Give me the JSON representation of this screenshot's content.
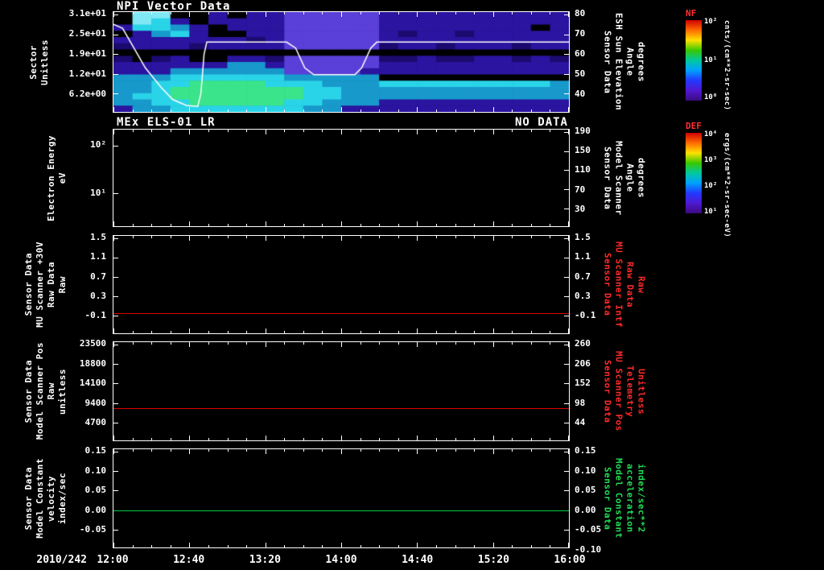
{
  "chart_data": [
    {
      "type": "heatmap",
      "title": "NPI Vector Data",
      "y_left": {
        "label_lines": [
          "Sector",
          "Unitless"
        ],
        "ticks": [
          "3.1e+01",
          "2.5e+01",
          "1.9e+01",
          "1.2e+01",
          "6.2e+00"
        ],
        "fracs": [
          0.024,
          0.222,
          0.42,
          0.619,
          0.817
        ]
      },
      "y_right": {
        "label_lines": [
          "Sensor Data",
          "ESH Sun Elevation",
          "Angle",
          "degrees"
        ],
        "ticks": [
          "80",
          "70",
          "60",
          "50",
          "40"
        ],
        "fracs": [
          0.024,
          0.222,
          0.42,
          0.619,
          0.817
        ],
        "color": "#ffffff"
      },
      "xlim": [
        "12:00",
        "16:00"
      ],
      "palette": {
        "K": "#000000",
        "N": "#1c0a6e",
        "D": "#2a14a0",
        "P": "#5a3fd8",
        "T": "#1899cc",
        "C": "#2ad4e8",
        "G": "#3ae48a",
        "L": "#7fe8f4"
      },
      "grid_rows": [
        "KLLKKDKDDPPPPPDDDDDDDDDD",
        "KLCDKDDDDPPPPPDDDDDDDDDD",
        "DCCTDKDDDPPPPPDDDDDDDDKD",
        "KDTCDKKDDPPPPPDNDDNDDDDD",
        "DDDDDDDNDPPPPPDDDDDDDDDD",
        "NDDDNDDDDPPPPPNDDNDDDNDD",
        "KKKKKKKKKKKKKKKKKKKKKKKK",
        "NKNDKKDDNPPPPPNNDNNDDNDN",
        "DDDDDDTTDPPPPPDDDDDDDDDD",
        "DDDTTTTTTPPPPDDDDDDDDDDD",
        "TTTCCCCCCTTTTTKKKKKKKKKK",
        "TTCCGGGGCCCTTTCCCCCCCCCT",
        "TTCGGGGGGGCCTTTTTTTTTTTT",
        "TCCGGGGGGGCCTTTTTTTTTTTT",
        "TTCCGGGGGCCTTTDDDDDDDDDD",
        "DTTCCCCCCCTTDDDDDDDDDDDD"
      ],
      "overlay_line": {
        "name": "ESH Sun Elevation Angle",
        "units": "degrees",
        "color": "#ffffff",
        "y_ref": {
          "top_value": 80,
          "frac_at_top": 0.024,
          "frac_per_degree": 0.0198
        },
        "points": [
          [
            0.0,
            75
          ],
          [
            0.02,
            73
          ],
          [
            0.045,
            63
          ],
          [
            0.07,
            53
          ],
          [
            0.105,
            43
          ],
          [
            0.13,
            37
          ],
          [
            0.16,
            34
          ],
          [
            0.185,
            33.5
          ],
          [
            0.192,
            40
          ],
          [
            0.199,
            60
          ],
          [
            0.205,
            66
          ],
          [
            0.38,
            66
          ],
          [
            0.4,
            63
          ],
          [
            0.42,
            53
          ],
          [
            0.44,
            49.5
          ],
          [
            0.53,
            49.5
          ],
          [
            0.545,
            53
          ],
          [
            0.565,
            63
          ],
          [
            0.578,
            66
          ],
          [
            1.0,
            66
          ]
        ]
      }
    },
    {
      "type": "spectrogram",
      "title": "MEx ELS-01 LR",
      "status": "NO DATA",
      "y_left": {
        "label_lines": [
          "Electron Energy",
          "eV"
        ],
        "ticks": [
          "10²",
          "10¹"
        ],
        "fracs": [
          0.164,
          0.656
        ]
      },
      "y_right": {
        "label_lines": [
          "Sensor Data",
          "Model Scanner",
          "Angle",
          "degrees"
        ],
        "ticks": [
          "190",
          "150",
          "110",
          "70",
          "30"
        ],
        "fracs": [
          0.024,
          0.222,
          0.42,
          0.619,
          0.817
        ],
        "color": "#ffffff"
      },
      "values": []
    },
    {
      "type": "line",
      "y_left": {
        "label_lines": [
          "Sensor Data",
          "MU Scanner +30V",
          "Raw Data",
          "Raw"
        ],
        "ticks": [
          "1.5",
          "1.1",
          "0.7",
          "0.3",
          "-0.1"
        ],
        "fracs": [
          0.024,
          0.222,
          0.42,
          0.619,
          0.817
        ]
      },
      "y_right": {
        "label_lines": [
          "Sensor Data",
          "MU Scanner Intf",
          "Raw Data",
          "Raw"
        ],
        "ticks": [
          "1.5",
          "1.1",
          "0.7",
          "0.3",
          "-0.1"
        ],
        "fracs": [
          0.024,
          0.222,
          0.42,
          0.619,
          0.817
        ],
        "color": "#ff2a2a"
      },
      "series": [
        {
          "name": "MU Scanner +30V Raw Data",
          "color": "#dd0000",
          "constant_value": -0.05,
          "frac": 0.79
        }
      ]
    },
    {
      "type": "line",
      "y_left": {
        "label_lines": [
          "Sensor Data",
          "Model Scanner Pos",
          "Raw",
          "unitless"
        ],
        "ticks": [
          "23500",
          "18800",
          "14100",
          "9400",
          "4700"
        ],
        "fracs": [
          0.024,
          0.222,
          0.42,
          0.619,
          0.817
        ]
      },
      "y_right": {
        "label_lines": [
          "Sensor Data",
          "MU Scanner Pos",
          "Telemetry",
          "Unitless"
        ],
        "ticks": [
          "260",
          "206",
          "152",
          "98",
          "44"
        ],
        "fracs": [
          0.024,
          0.222,
          0.42,
          0.619,
          0.817
        ],
        "color": "#ff2a2a"
      },
      "series": [
        {
          "name": "Model Scanner Pos Raw",
          "color": "#dd0000",
          "constant_value": 8000,
          "frac": 0.675
        }
      ]
    },
    {
      "type": "line",
      "y_left": {
        "label_lines": [
          "Sensor Data",
          "Model Constant",
          "velocity",
          "index/sec"
        ],
        "ticks": [
          "0.15",
          "0.10",
          "0.05",
          "0.00",
          "-0.05"
        ],
        "fracs": [
          0.024,
          0.222,
          0.42,
          0.619,
          0.817
        ]
      },
      "y_right": {
        "label_lines": [
          "Sensor Data",
          "Model Constant",
          "acceleration",
          "index/sec**2"
        ],
        "ticks": [
          "0.15",
          "0.10",
          "0.05",
          "0.00",
          "-0.05",
          "-0.10"
        ],
        "fracs": [
          0.024,
          0.222,
          0.42,
          0.619,
          0.817,
          1.015
        ],
        "color": "#22dd55"
      },
      "series": [
        {
          "name": "Model Constant velocity",
          "color": "#00cc44",
          "constant_value": 0.0,
          "frac": 0.619
        }
      ]
    }
  ],
  "x_axis": {
    "date": "2010/242",
    "times": [
      "12:00",
      "12:40",
      "13:20",
      "14:00",
      "14:40",
      "15:20",
      "16:00"
    ]
  },
  "colorbars": [
    {
      "tag": "NF",
      "tag_color": "#ff3030",
      "unit": "cnts/(cm**2-sr-sec)",
      "ticks": [
        "10²",
        "10¹",
        "10⁰"
      ],
      "fracs": [
        0.02,
        0.5,
        0.96
      ],
      "gradient": [
        "#d00000",
        "#ff6a00",
        "#ffe000",
        "#38c800",
        "#00c8a0",
        "#00a0ff",
        "#2238ff",
        "#5018d0",
        "#3a0a80"
      ]
    },
    {
      "tag": "DEF",
      "tag_color": "#ff3030",
      "unit": "ergs/(cm**2-sr-sec-eV)",
      "ticks": [
        "10⁴",
        "10³",
        "10²",
        "10¹"
      ],
      "fracs": [
        0.02,
        0.34,
        0.66,
        0.98
      ],
      "gradient": [
        "#d00000",
        "#ff6a00",
        "#ffe000",
        "#38c800",
        "#00c8a0",
        "#00a0ff",
        "#2238ff",
        "#5018d0",
        "#3a0a80"
      ]
    }
  ]
}
